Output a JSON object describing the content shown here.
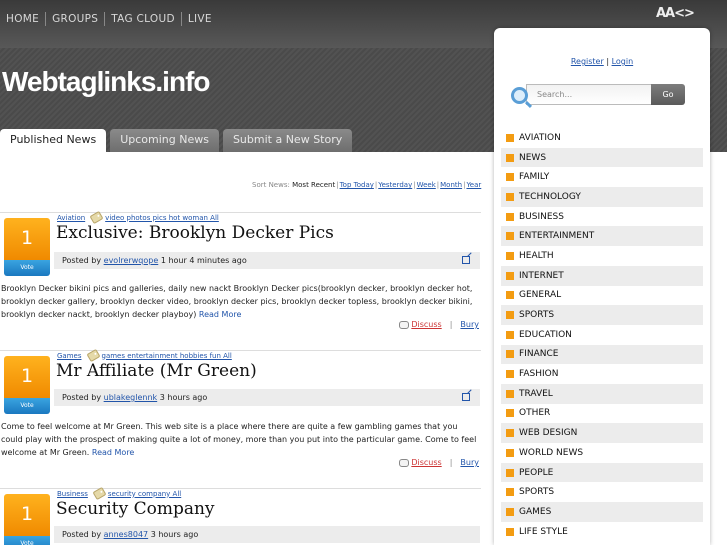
{
  "topnav": [
    "HOME",
    "GROUPS",
    "TAG CLOUD",
    "LIVE"
  ],
  "font_tools": "AA<>",
  "site_title": "Webtaglinks.info",
  "tabs": [
    "Published News",
    "Upcoming News",
    "Submit a New Story"
  ],
  "sort": {
    "label": "Sort News:",
    "current": "Most Recent",
    "options": [
      "Top Today",
      "Yesterday",
      "Week",
      "Month",
      "Year"
    ]
  },
  "stories": [
    {
      "votes": "1",
      "vote_label": "Vote",
      "category": "Aviation",
      "tags": "video photos pics hot woman All",
      "title": "Exclusive: Brooklyn Decker Pics",
      "posted_by": "Posted by",
      "user": "evolrerwqope",
      "time": "1 hour 4 minutes ago",
      "desc": "Brooklyn Decker bikini pics and galleries, daily new nackt Brooklyn Decker pics(brooklyn decker, brooklyn decker hot, brooklyn decker gallery, brooklyn decker video, brooklyn decker pics, brooklyn decker topless, brooklyn decker bikini, brooklyn decker nackt, brooklyn decker playboy)",
      "read_more": "Read More",
      "discuss": "Discuss",
      "bury": "Bury"
    },
    {
      "votes": "1",
      "vote_label": "Vote",
      "category": "Games",
      "tags": "games entertainment hobbies fun All",
      "title": "Mr Affiliate (Mr Green)",
      "posted_by": "Posted by",
      "user": "ublakeglennk",
      "time": "3 hours ago",
      "desc": "Come to feel welcome at Mr Green. This web site is a place where there are quite a few gambling games that you could play with the prospect of making quite a lot of money, more than you put into the particular game. Come to feel welcome at Mr Green.",
      "read_more": "Read More",
      "discuss": "Discuss",
      "bury": "Bury"
    },
    {
      "votes": "1",
      "vote_label": "Vote",
      "category": "Business",
      "tags": "security company All",
      "title": "Security Company",
      "posted_by": "Posted by",
      "user": "annes8047",
      "time": "3 hours ago"
    }
  ],
  "auth": {
    "register": "Register",
    "sep": "|",
    "login": "Login"
  },
  "search": {
    "placeholder": "Search...",
    "button": "Go"
  },
  "categories": [
    "AVIATION",
    "NEWS",
    "FAMILY",
    "TECHNOLOGY",
    "BUSINESS",
    "ENTERTAINMENT",
    "HEALTH",
    "INTERNET",
    "GENERAL",
    "SPORTS",
    "EDUCATION",
    "FINANCE",
    "FASHION",
    "TRAVEL",
    "OTHER",
    "WEB DESIGN",
    "WORLD NEWS",
    "PEOPLE",
    "SPORTS",
    "GAMES",
    "LIFE STYLE"
  ],
  "colors": {
    "accent": "#f39c12",
    "link": "#2255aa",
    "vote": "#1a78c0"
  }
}
